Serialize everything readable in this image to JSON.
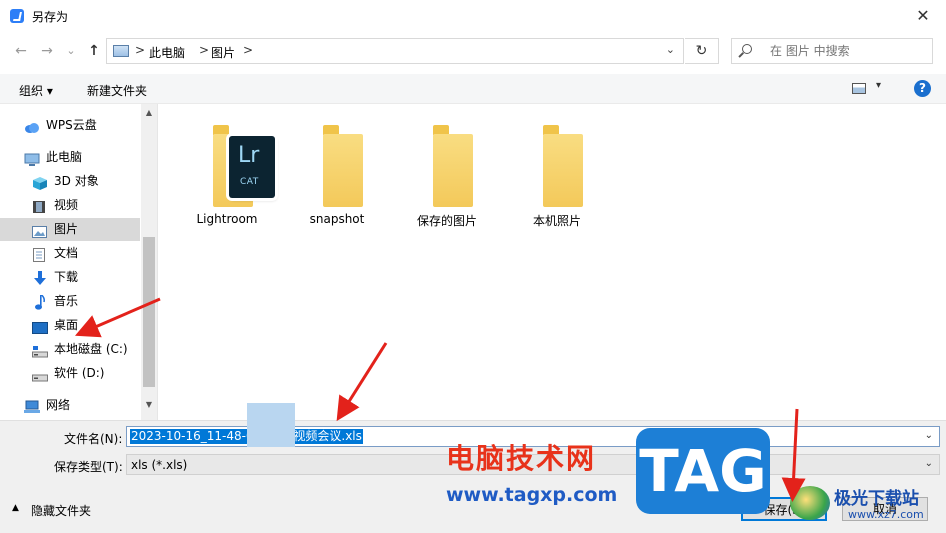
{
  "window": {
    "title": "另存为",
    "close_glyph": "✕"
  },
  "nav": {
    "back_glyph": "←",
    "forward_glyph": "→",
    "up_glyph": "↑",
    "recent_glyph": "⌄",
    "refresh_glyph": "↻"
  },
  "address": {
    "crumbs": [
      "此电脑",
      "图片"
    ],
    "separator": ">",
    "dropdown_glyph": "⌄"
  },
  "search": {
    "placeholder": "在 图片 中搜索"
  },
  "toolbar": {
    "organize": "组织 ▾",
    "new_folder": "新建文件夹",
    "view_dropdown": "▾",
    "help": "?"
  },
  "sidebar": {
    "items": [
      {
        "label": "WPS云盘",
        "icon": "cloud-icon"
      },
      {
        "label": "此电脑",
        "icon": "computer-icon"
      },
      {
        "label": "3D 对象",
        "icon": "cube-icon"
      },
      {
        "label": "视频",
        "icon": "film-icon"
      },
      {
        "label": "图片",
        "icon": "picture-icon",
        "selected": true
      },
      {
        "label": "文档",
        "icon": "document-icon"
      },
      {
        "label": "下载",
        "icon": "download-icon"
      },
      {
        "label": "音乐",
        "icon": "music-icon"
      },
      {
        "label": "桌面",
        "icon": "desktop-icon"
      },
      {
        "label": "本地磁盘 (C:)",
        "icon": "drive-icon"
      },
      {
        "label": "软件 (D:)",
        "icon": "drive-icon"
      },
      {
        "label": "网络",
        "icon": "network-icon"
      }
    ],
    "scroll_up": "▲",
    "scroll_down": "▼"
  },
  "folders": [
    {
      "name": "Lightroom",
      "badge_top": "Lr",
      "badge_bottom": "CAT"
    },
    {
      "name": "snapshot"
    },
    {
      "name": "保存的图片"
    },
    {
      "name": "本机照片"
    }
  ],
  "form": {
    "filename_label": "文件名(N):",
    "filename_value": "2023-10-16_11-48-0     发起的视频会议.xls",
    "filetype_label": "保存类型(T):",
    "filetype_value": "xls (*.xls)",
    "dropdown_glyph": "⌄",
    "hide_folders": "隐藏文件夹",
    "hide_chevron": "▲",
    "save_button": "保存(S)",
    "cancel_button": "取消"
  },
  "watermark": {
    "site_name": "电脑技术网",
    "site_url": "www.tagxp.com",
    "tag": "TAG",
    "brand": "极光下载站",
    "brand_url": "www.xz7.com"
  },
  "colors": {
    "accent": "#0078d7",
    "annotation_arrow": "#e3221b",
    "folder": "#f6d46f"
  }
}
